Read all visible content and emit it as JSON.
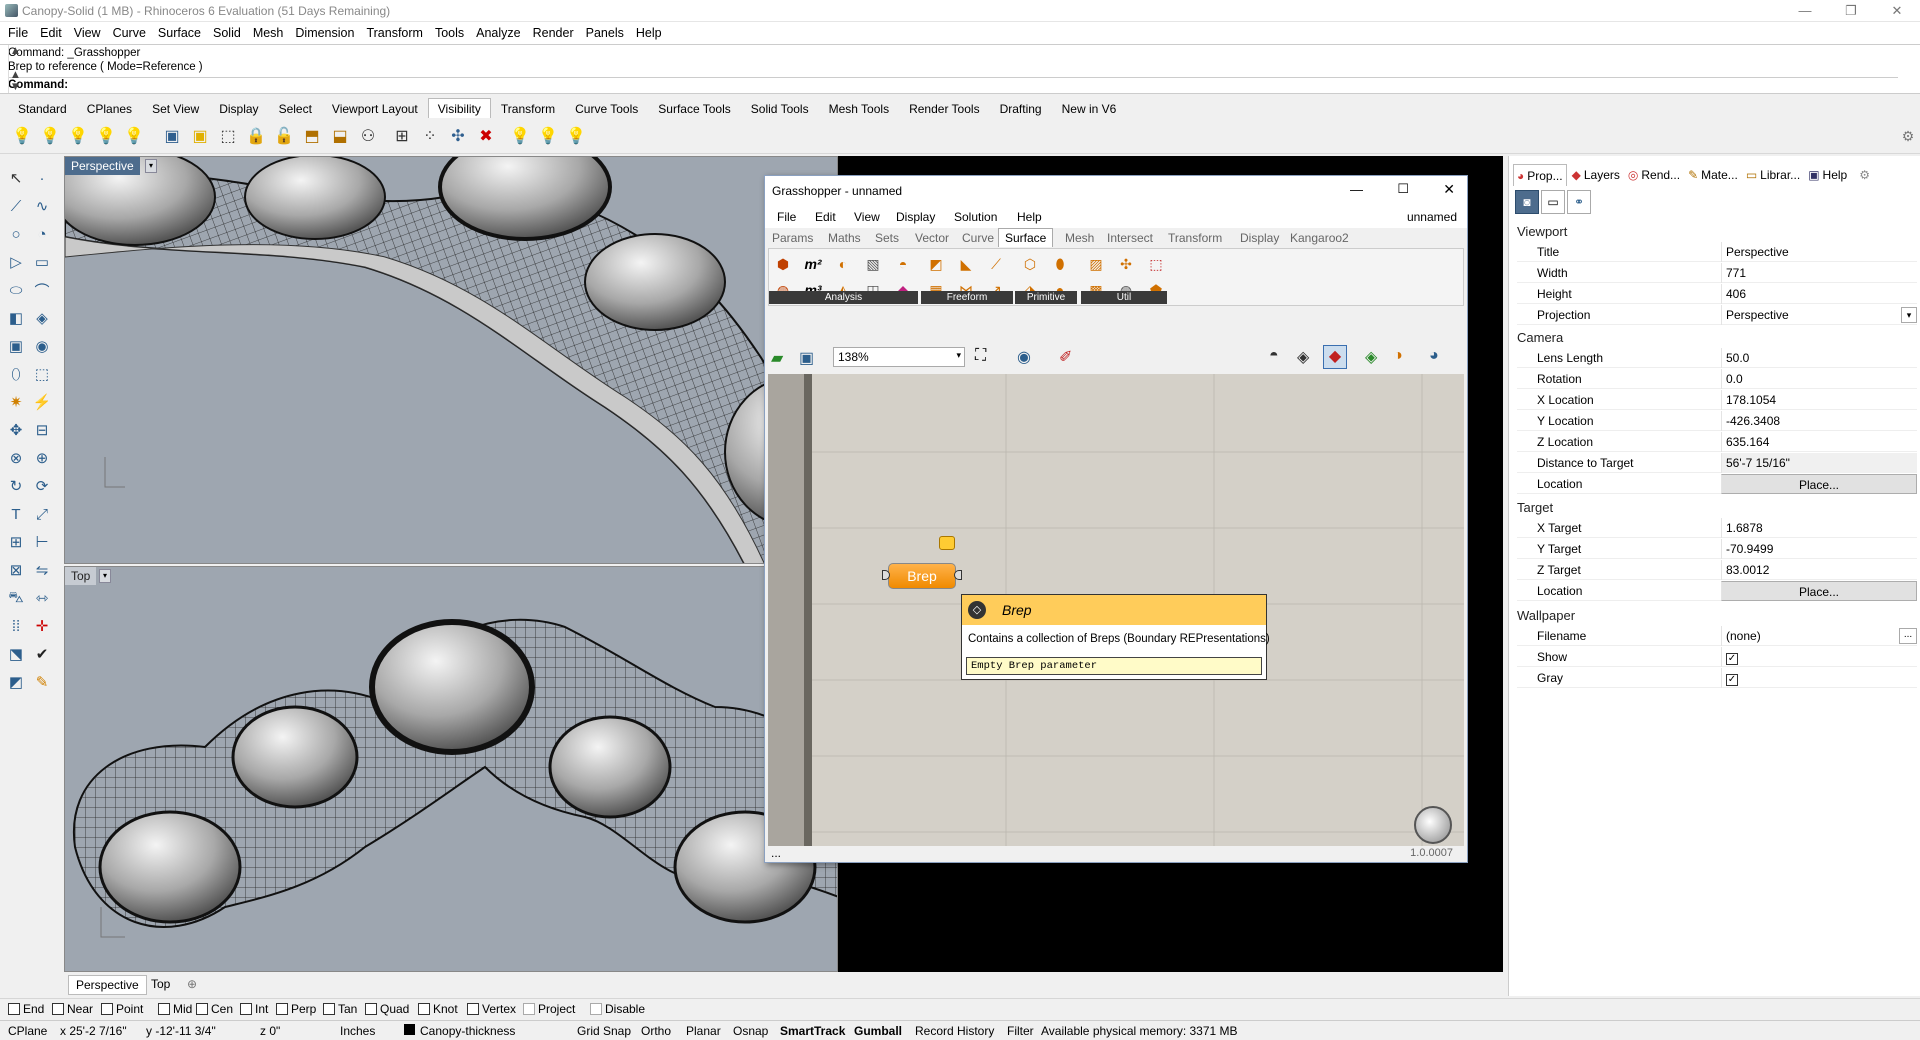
{
  "window": {
    "title": "Canopy-Solid (1 MB) - Rhinoceros 6 Evaluation (51 Days Remaining)"
  },
  "menu": [
    "File",
    "Edit",
    "View",
    "Curve",
    "Surface",
    "Solid",
    "Mesh",
    "Dimension",
    "Transform",
    "Tools",
    "Analyze",
    "Render",
    "Panels",
    "Help"
  ],
  "command": {
    "line1": "Command: _Grasshopper",
    "line2": "Brep to reference ( Mode=Reference )",
    "prompt": "Command:"
  },
  "toolbar_tabs": [
    "Standard",
    "CPlanes",
    "Set View",
    "Display",
    "Select",
    "Viewport Layout",
    "Visibility",
    "Transform",
    "Curve Tools",
    "Surface Tools",
    "Solid Tools",
    "Mesh Tools",
    "Render Tools",
    "Drafting",
    "New in V6"
  ],
  "active_tab": "Visibility",
  "viewports": {
    "perspective": "Perspective",
    "top": "Top"
  },
  "viewport_tabs": [
    "Perspective",
    "Top"
  ],
  "osnap": [
    {
      "label": "End",
      "checked": false
    },
    {
      "label": "Near",
      "checked": false
    },
    {
      "label": "Point",
      "checked": false
    },
    {
      "label": "Mid",
      "checked": false
    },
    {
      "label": "Cen",
      "checked": false
    },
    {
      "label": "Int",
      "checked": false
    },
    {
      "label": "Perp",
      "checked": false
    },
    {
      "label": "Tan",
      "checked": false
    },
    {
      "label": "Quad",
      "checked": false
    },
    {
      "label": "Knot",
      "checked": false
    },
    {
      "label": "Vertex",
      "checked": false
    },
    {
      "label": "Project",
      "checked": false
    },
    {
      "label": "Disable",
      "checked": false
    }
  ],
  "status": {
    "cplane": "CPlane",
    "x": "x 25'-2 7/16\"",
    "y": "y -12'-11 3/4\"",
    "z": "z 0\"",
    "units": "Inches",
    "layer": "Canopy-thickness",
    "toggles": [
      "Grid Snap",
      "Ortho",
      "Planar",
      "Osnap",
      "SmartTrack",
      "Gumball",
      "Record History",
      "Filter"
    ],
    "memory": "Available physical memory: 3371 MB"
  },
  "panel": {
    "tabs": [
      "Prop...",
      "Layers",
      "Rend...",
      "Mate...",
      "Librar...",
      "Help"
    ],
    "viewport_section": "Viewport",
    "viewport": [
      {
        "k": "Title",
        "v": "Perspective"
      },
      {
        "k": "Width",
        "v": "771"
      },
      {
        "k": "Height",
        "v": "406"
      },
      {
        "k": "Projection",
        "v": "Perspective"
      }
    ],
    "camera_section": "Camera",
    "camera": [
      {
        "k": "Lens Length",
        "v": "50.0"
      },
      {
        "k": "Rotation",
        "v": "0.0"
      },
      {
        "k": "X Location",
        "v": "178.1054"
      },
      {
        "k": "Y Location",
        "v": "-426.3408"
      },
      {
        "k": "Z Location",
        "v": "635.164"
      },
      {
        "k": "Distance to Target",
        "v": "56'-7 15/16\""
      },
      {
        "k": "Location",
        "v": "Place..."
      }
    ],
    "target_section": "Target",
    "target": [
      {
        "k": "X Target",
        "v": "1.6878"
      },
      {
        "k": "Y Target",
        "v": "-70.9499"
      },
      {
        "k": "Z Target",
        "v": "83.0012"
      },
      {
        "k": "Location",
        "v": "Place..."
      }
    ],
    "wallpaper_section": "Wallpaper",
    "wallpaper": [
      {
        "k": "Filename",
        "v": "(none)"
      },
      {
        "k": "Show",
        "v": ""
      },
      {
        "k": "Gray",
        "v": ""
      }
    ],
    "wallpaper_ellipsis": "..."
  },
  "grasshopper": {
    "title": "Grasshopper - unnamed",
    "menu": [
      "File",
      "Edit",
      "View",
      "Display",
      "Solution",
      "Help"
    ],
    "doc": "unnamed",
    "tabs": [
      "Params",
      "Maths",
      "Sets",
      "Vector",
      "Curve",
      "Surface",
      "Mesh",
      "Intersect",
      "Transform",
      "Display",
      "Kangaroo2"
    ],
    "active_tab": "Surface",
    "groups": [
      "Analysis",
      "Freeform",
      "Primitive",
      "Util"
    ],
    "zoom": "138%",
    "component": "Brep",
    "tooltip": {
      "title": "Brep",
      "desc": "Contains a collection of Breps (Boundary REPresentations)",
      "status": "Empty Brep parameter"
    },
    "footer_left": "...",
    "version": "1.0.0007"
  }
}
